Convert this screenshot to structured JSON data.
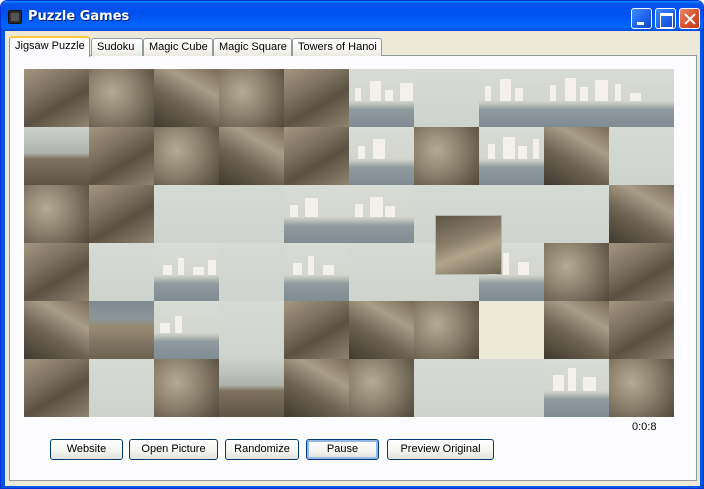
{
  "window": {
    "title": "Puzzle Games"
  },
  "tabs": [
    {
      "label": "Jigsaw Puzzle",
      "active": true
    },
    {
      "label": "Sudoku",
      "active": false
    },
    {
      "label": "Magic Cube",
      "active": false
    },
    {
      "label": "Magic Square",
      "active": false
    },
    {
      "label": "Towers of Hanoi",
      "active": false
    }
  ],
  "puzzle": {
    "rows": 6,
    "columns": 10,
    "empty_slot": {
      "row": 4,
      "column": 7
    }
  },
  "timer": "0:0:8",
  "buttons": {
    "website": "Website",
    "open_picture": "Open Picture",
    "randomize": "Randomize",
    "pause": "Pause",
    "preview_original": "Preview Original"
  },
  "colors": {
    "titlebar": "#0053ee",
    "window_bg": "#ece9d8",
    "close_button": "#d9502c",
    "tab_highlight": "#ffc83c"
  },
  "icons": [
    "app-icon",
    "minimize-icon",
    "maximize-icon",
    "close-icon"
  ]
}
